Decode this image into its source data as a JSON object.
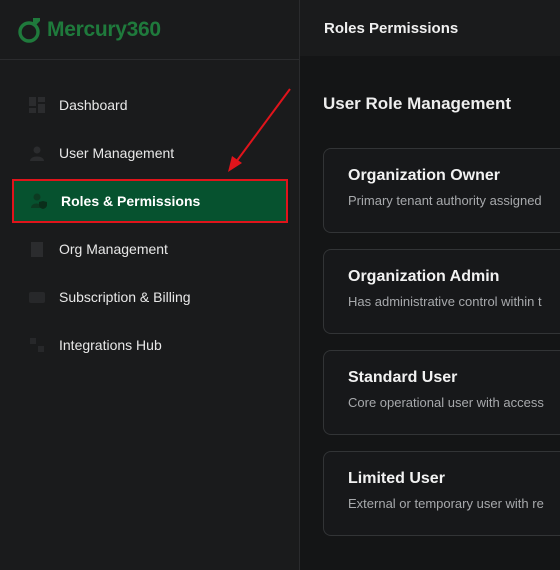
{
  "brand": {
    "name": "Mercury360",
    "color": "#1f7a3c"
  },
  "header": {
    "title": "Roles Permissions"
  },
  "sidebar": {
    "items": [
      {
        "label": "Dashboard",
        "icon": "dashboard-icon"
      },
      {
        "label": "User Management",
        "icon": "user-icon"
      },
      {
        "label": "Roles & Permissions",
        "icon": "user-shield-icon",
        "active": true
      },
      {
        "label": "Org Management",
        "icon": "building-icon"
      },
      {
        "label": "Subscription & Billing",
        "icon": "billing-icon"
      },
      {
        "label": "Integrations Hub",
        "icon": "integrations-icon"
      }
    ]
  },
  "main": {
    "section_title": "User Role Management",
    "roles": [
      {
        "name": "Organization Owner",
        "description": "Primary tenant authority assigned"
      },
      {
        "name": "Organization Admin",
        "description": "Has administrative control within t"
      },
      {
        "name": "Standard User",
        "description": "Core operational user with access"
      },
      {
        "name": "Limited User",
        "description": "External or temporary user with re"
      }
    ]
  },
  "colors": {
    "active_bg": "#06522f",
    "highlight_border": "#e0141b",
    "annotation_arrow": "#e0141b"
  }
}
